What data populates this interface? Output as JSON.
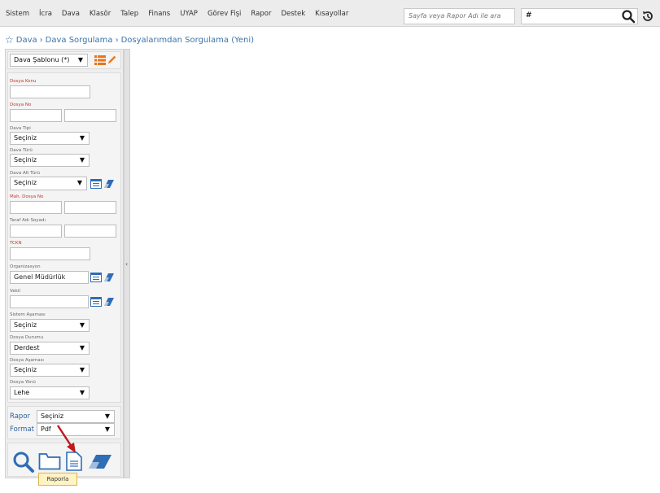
{
  "menu": [
    "Sistem",
    "İcra",
    "Dava",
    "Klasör",
    "Talep",
    "Finans",
    "UYAP",
    "Görev Fişi",
    "Rapor",
    "Destek",
    "Kısayollar"
  ],
  "search": {
    "placeholder": "Sayfa veya Rapor Adı ile ara",
    "hash_value": "#"
  },
  "breadcrumb": {
    "item1": "Dava",
    "item2": "Dava Sorgulama",
    "item3": "Dosyalarımdan Sorgulama (Yeni)"
  },
  "template": {
    "value": "Dava Şablonu (*)"
  },
  "fields": {
    "dosya_konu": "Dosya Konu",
    "dosya_no": "Dosya No",
    "dava_tipi": "Dava Tipi",
    "dava_tipi_value": "Seçiniz",
    "dava_turu": "Dava Türü",
    "dava_turu_value": "Seçiniz",
    "dava_alt_turu": "Dava Alt Türü",
    "dava_alt_turu_value": "Seçiniz",
    "mah_dosya_no": "Mah. Dosya No",
    "taraf_adi": "Taraf Adı Soyadı",
    "tckn": "TCKN",
    "organizasyon": "Organizasyon",
    "organizasyon_value": "Genel Müdürlük",
    "vekil": "Vekil",
    "sistem_asamasi": "Sistem Aşaması",
    "sistem_asamasi_value": "Seçiniz",
    "dosya_durumu": "Dosya Durumu",
    "dosya_durumu_value": "Derdest",
    "dosya_asamasi": "Dosya Aşaması",
    "dosya_asamasi_value": "Seçiniz",
    "dosya_yonu": "Dosya Yönü",
    "dosya_yonu_value": "Lehe"
  },
  "report": {
    "rapor_label": "Rapor",
    "rapor_value": "Seçiniz",
    "format_label": "Format",
    "format_value": "Pdf"
  },
  "tooltip": "Raporla",
  "colors": {
    "accent": "#3b73a8",
    "red_label": "#c0392b",
    "annotation_arrow": "#c0181b"
  }
}
